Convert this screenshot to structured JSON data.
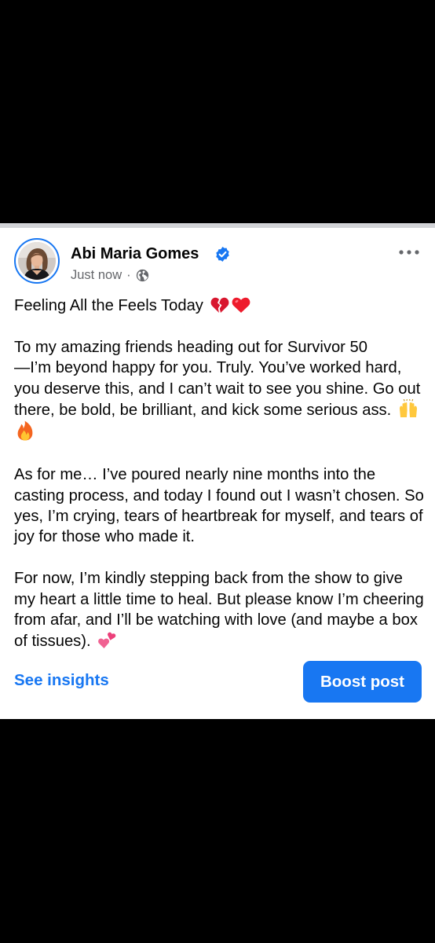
{
  "post": {
    "author_name": "Abi Maria Gomes",
    "timestamp": "Just now",
    "separator": "·",
    "icons": {
      "avatar": "profile-photo",
      "verified": "verified-badge-icon",
      "audience": "globe-icon",
      "more": "more-options-icon"
    },
    "paragraphs": [
      {
        "text": "Feeling All the Feels Today",
        "emojis": [
          "broken-heart",
          "red-heart"
        ]
      },
      {
        "text": "To my amazing friends heading out for Survivor 50\n—I’m beyond happy for you. Truly. You’ve worked hard, you deserve this, and I can’t wait to see you shine. Go out there, be bold, be brilliant, and kick some serious ass.",
        "emojis": [
          "raising-hands",
          "fire"
        ]
      },
      {
        "text": "As for me… I’ve poured nearly nine months into the casting process, and today I found out I wasn’t chosen. So yes, I’m crying, tears of heartbreak for myself, and tears of joy for those who made it.",
        "emojis": []
      },
      {
        "text": "For now, I’m kindly stepping back from the show to give my heart a little time to heal. But please know I’m cheering from afar, and I’ll be watching with love (and maybe a box of tissues).",
        "emojis": [
          "two-hearts"
        ]
      }
    ]
  },
  "actions": {
    "see_insights": "See insights",
    "boost_post": "Boost post"
  },
  "colors": {
    "accent": "#1877f2",
    "text": "#050505",
    "secondary_text": "#65676b",
    "background": "#ffffff",
    "letterbox": "#000000"
  }
}
